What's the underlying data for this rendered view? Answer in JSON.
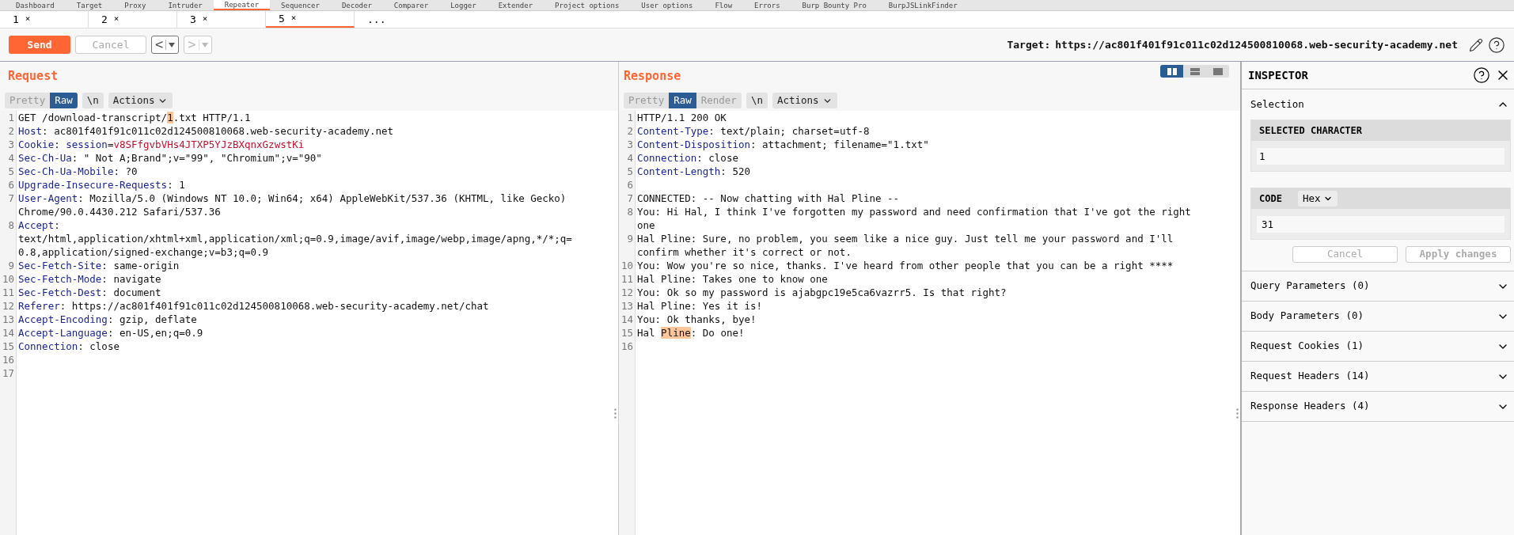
{
  "main_tabs": [
    {
      "label": "Dashboard",
      "selected": false
    },
    {
      "label": "Target",
      "selected": false
    },
    {
      "label": "Proxy",
      "selected": false
    },
    {
      "label": "Intruder",
      "selected": false
    },
    {
      "label": "Repeater",
      "selected": true
    },
    {
      "label": "Sequencer",
      "selected": false
    },
    {
      "label": "Decoder",
      "selected": false
    },
    {
      "label": "Comparer",
      "selected": false
    },
    {
      "label": "Logger",
      "selected": false
    },
    {
      "label": "Extender",
      "selected": false
    },
    {
      "label": "Project options",
      "selected": false
    },
    {
      "label": "User options",
      "selected": false
    },
    {
      "label": "Flow",
      "selected": false
    },
    {
      "label": "Errors",
      "selected": false
    },
    {
      "label": "Burp Bounty Pro",
      "selected": false
    },
    {
      "label": "BurpJSLinkFinder",
      "selected": false
    }
  ],
  "repeater_tabs": [
    {
      "label": "1",
      "close": "×",
      "selected": false
    },
    {
      "label": "2",
      "close": "×",
      "selected": false
    },
    {
      "label": "3",
      "close": "×",
      "selected": false
    },
    {
      "label": "5",
      "close": "×",
      "selected": true
    }
  ],
  "more_tabs": "...",
  "toolbar": {
    "send": "Send",
    "cancel": "Cancel",
    "cancel_disabled": true,
    "back": "<",
    "back_disabled": false,
    "forward": ">",
    "forward_disabled": true,
    "target_label": "Target:",
    "target_url": "https://ac801f401f91c011c02d124500810068.web-security-academy.net"
  },
  "request": {
    "title": "Request",
    "view_tabs": [
      {
        "label": "Pretty",
        "selected": false
      },
      {
        "label": "Raw",
        "selected": true
      }
    ],
    "newline_toggle": "\\n",
    "actions": "Actions",
    "lines": [
      {
        "number": "1",
        "parts": [
          {
            "kind": "plain",
            "text": "GET /download-transcript/"
          },
          {
            "kind": "highlight",
            "text": "1"
          },
          {
            "kind": "plain",
            "text": ".txt HTTP/1.1"
          }
        ]
      },
      {
        "number": "2",
        "parts": [
          {
            "kind": "header",
            "text": "Host"
          },
          {
            "kind": "plain",
            "text": ": ac801f401f91c011c02d124500810068.web-security-academy.net"
          }
        ]
      },
      {
        "number": "3",
        "parts": [
          {
            "kind": "header",
            "text": "Cookie"
          },
          {
            "kind": "plain",
            "text": ": "
          },
          {
            "kind": "header",
            "text": "session"
          },
          {
            "kind": "plain",
            "text": "="
          },
          {
            "kind": "cookie",
            "text": "v8SFfgvbVHs4JTXP5YJzBXqnxGzwstKi"
          }
        ]
      },
      {
        "number": "4",
        "parts": [
          {
            "kind": "header",
            "text": "Sec-Ch-Ua"
          },
          {
            "kind": "plain",
            "text": ": \" Not A;Brand\";v=\"99\", \"Chromium\";v=\"90\""
          }
        ]
      },
      {
        "number": "5",
        "parts": [
          {
            "kind": "header",
            "text": "Sec-Ch-Ua-Mobile"
          },
          {
            "kind": "plain",
            "text": ": ?0"
          }
        ]
      },
      {
        "number": "6",
        "parts": [
          {
            "kind": "header",
            "text": "Upgrade-Insecure-Requests"
          },
          {
            "kind": "plain",
            "text": ": 1"
          }
        ]
      },
      {
        "number": "7",
        "parts": [
          {
            "kind": "header",
            "text": "User-Agent"
          },
          {
            "kind": "plain",
            "text": ": Mozilla/5.0 (Windows NT 10.0; Win64; x64) AppleWebKit/537.36 (KHTML, like Gecko) Chrome/90.0.4430.212 Safari/537.36"
          }
        ]
      },
      {
        "number": "8",
        "parts": [
          {
            "kind": "header",
            "text": "Accept"
          },
          {
            "kind": "plain",
            "text": ": text/html,application/xhtml+xml,application/xml;q=0.9,image/avif,image/webp,image/apng,*/*;q=0.8,application/signed-exchange;v=b3;q=0.9"
          }
        ]
      },
      {
        "number": "9",
        "parts": [
          {
            "kind": "header",
            "text": "Sec-Fetch-Site"
          },
          {
            "kind": "plain",
            "text": ": same-origin"
          }
        ]
      },
      {
        "number": "10",
        "parts": [
          {
            "kind": "header",
            "text": "Sec-Fetch-Mode"
          },
          {
            "kind": "plain",
            "text": ": navigate"
          }
        ]
      },
      {
        "number": "11",
        "parts": [
          {
            "kind": "header",
            "text": "Sec-Fetch-Dest"
          },
          {
            "kind": "plain",
            "text": ": document"
          }
        ]
      },
      {
        "number": "12",
        "parts": [
          {
            "kind": "header",
            "text": "Referer"
          },
          {
            "kind": "plain",
            "text": ": https://ac801f401f91c011c02d124500810068.web-security-academy.net/chat"
          }
        ]
      },
      {
        "number": "13",
        "parts": [
          {
            "kind": "header",
            "text": "Accept-Encoding"
          },
          {
            "kind": "plain",
            "text": ": gzip, deflate"
          }
        ]
      },
      {
        "number": "14",
        "parts": [
          {
            "kind": "header",
            "text": "Accept-Language"
          },
          {
            "kind": "plain",
            "text": ": en-US,en;q=0.9"
          }
        ]
      },
      {
        "number": "15",
        "parts": [
          {
            "kind": "header",
            "text": "Connection"
          },
          {
            "kind": "plain",
            "text": ": close"
          }
        ]
      },
      {
        "number": "16"
      },
      {
        "number": "17"
      }
    ]
  },
  "response": {
    "title": "Response",
    "layout_buttons": [
      {
        "kind": "side-by-side",
        "selected": true
      },
      {
        "kind": "stacked",
        "selected": false
      },
      {
        "kind": "single",
        "selected": false
      }
    ],
    "view_tabs": [
      {
        "label": "Pretty",
        "selected": false
      },
      {
        "label": "Raw",
        "selected": true
      },
      {
        "label": "Render",
        "selected": false
      }
    ],
    "newline_toggle": "\\n",
    "actions": "Actions",
    "lines": [
      {
        "number": "1",
        "parts": [
          {
            "kind": "plain",
            "text": "HTTP/1.1 200 OK"
          }
        ]
      },
      {
        "number": "2",
        "parts": [
          {
            "kind": "header",
            "text": "Content-Type"
          },
          {
            "kind": "plain",
            "text": ": text/plain; charset=utf-8"
          }
        ]
      },
      {
        "number": "3",
        "parts": [
          {
            "kind": "header",
            "text": "Content-Disposition"
          },
          {
            "kind": "plain",
            "text": ": attachment; filename=\"1.txt\""
          }
        ]
      },
      {
        "number": "4",
        "parts": [
          {
            "kind": "header",
            "text": "Connection"
          },
          {
            "kind": "plain",
            "text": ": close"
          }
        ]
      },
      {
        "number": "5",
        "parts": [
          {
            "kind": "header",
            "text": "Content-Length"
          },
          {
            "kind": "plain",
            "text": ": 520"
          }
        ]
      },
      {
        "number": "6"
      },
      {
        "number": "7",
        "parts": [
          {
            "kind": "plain",
            "text": "CONNECTED: -- Now chatting with Hal Pline --"
          }
        ]
      },
      {
        "number": "8",
        "parts": [
          {
            "kind": "plain",
            "text": "You: Hi Hal, I think I've forgotten my password and need confirmation that I've got the right one"
          }
        ]
      },
      {
        "number": "9",
        "parts": [
          {
            "kind": "plain",
            "text": "Hal Pline: Sure, no problem, you seem like a nice guy. Just tell me your password and I'll confirm whether it's correct or not."
          }
        ]
      },
      {
        "number": "10",
        "parts": [
          {
            "kind": "plain",
            "text": "You: Wow you're so nice, thanks. I've heard from other people that you can be a right ****"
          }
        ]
      },
      {
        "number": "11",
        "parts": [
          {
            "kind": "plain",
            "text": "Hal Pline: Takes one to know one"
          }
        ]
      },
      {
        "number": "12",
        "parts": [
          {
            "kind": "plain",
            "text": "You: Ok so my password is ajabgpc19e5ca6vazrr5. Is that right?"
          }
        ]
      },
      {
        "number": "13",
        "parts": [
          {
            "kind": "plain",
            "text": "Hal Pline: Yes it is!"
          }
        ]
      },
      {
        "number": "14",
        "parts": [
          {
            "kind": "plain",
            "text": "You: Ok thanks, bye!"
          }
        ]
      },
      {
        "number": "15",
        "parts": [
          {
            "kind": "plain",
            "text": "Hal "
          },
          {
            "kind": "highlight",
            "text": "Pline"
          },
          {
            "kind": "plain",
            "text": ": Do one!"
          }
        ]
      },
      {
        "number": "16"
      }
    ]
  },
  "inspector": {
    "title": "INSPECTOR",
    "selection": {
      "title": "Selection",
      "expanded": true,
      "selected_character_label": "SELECTED CHARACTER",
      "selected_character": "1",
      "code_label": "CODE",
      "code_format": "Hex",
      "code_value": "31",
      "cancel": "Cancel",
      "apply": "Apply changes",
      "buttons_disabled": true
    },
    "sections": [
      {
        "title": "Query Parameters (0)",
        "expanded": false
      },
      {
        "title": "Body Parameters (0)",
        "expanded": false
      },
      {
        "title": "Request Cookies (1)",
        "expanded": false
      },
      {
        "title": "Request Headers (14)",
        "expanded": false
      },
      {
        "title": "Response Headers (4)",
        "expanded": false
      }
    ]
  }
}
